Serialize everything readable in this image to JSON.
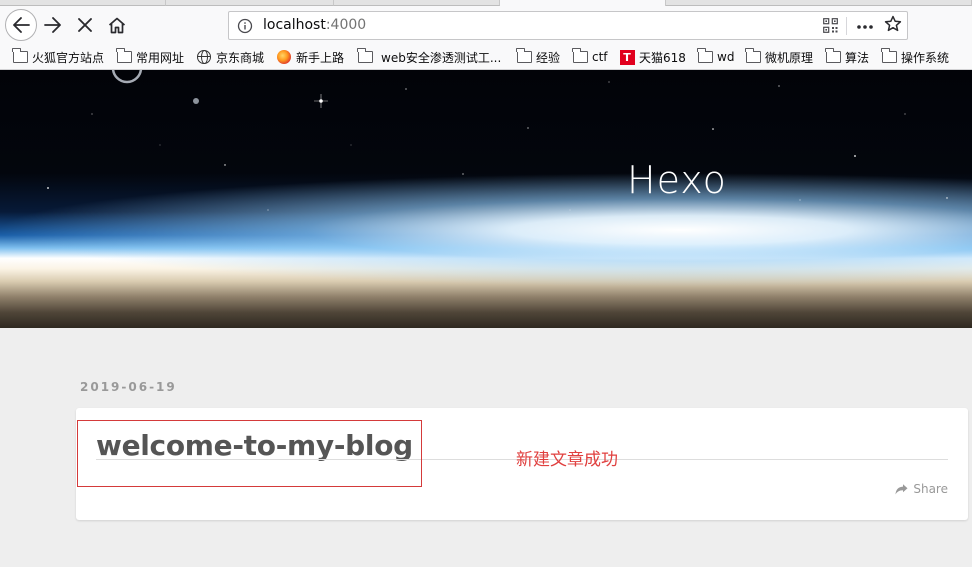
{
  "browser": {
    "url_host": "localhost",
    "url_port": ":4000",
    "icons": {
      "back": "back-arrow-icon",
      "forward": "forward-arrow-icon",
      "stop": "stop-x-icon",
      "home": "home-icon",
      "info": "info-circle-icon",
      "qr": "qr-code-icon",
      "more": "more-dots-icon",
      "star": "star-icon"
    }
  },
  "bookmarks": [
    {
      "label": "火狐官方站点",
      "icon": "folder"
    },
    {
      "label": "常用网址",
      "icon": "folder"
    },
    {
      "label": "京东商城",
      "icon": "globe"
    },
    {
      "label": "新手上路",
      "icon": "firefox"
    },
    {
      "label": "web安全渗透测试工...",
      "icon": "folder"
    },
    {
      "label": "经验",
      "icon": "folder"
    },
    {
      "label": "ctf",
      "icon": "folder"
    },
    {
      "label": "天猫618",
      "icon": "tmall"
    },
    {
      "label": "wd",
      "icon": "folder"
    },
    {
      "label": "微机原理",
      "icon": "folder"
    },
    {
      "label": "算法",
      "icon": "folder"
    },
    {
      "label": "操作系统",
      "icon": "folder"
    }
  ],
  "site": {
    "title": "Hexo"
  },
  "post": {
    "date": "2019-06-19",
    "title": "welcome-to-my-blog",
    "share_label": "Share"
  },
  "annotation": {
    "text": "新建文章成功",
    "color": "#e0403f"
  }
}
